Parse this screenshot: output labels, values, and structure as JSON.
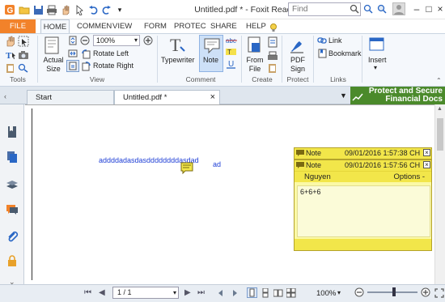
{
  "window": {
    "title": "Untitled.pdf * - Foxit Reader",
    "find_placeholder": "Find"
  },
  "ribbon_tabs": [
    "FILE",
    "HOME",
    "COMMEN",
    "VIEW",
    "FORM",
    "PROTEC",
    "SHARE",
    "HELP"
  ],
  "ribbon": {
    "tools": {
      "label": "Tools"
    },
    "view": {
      "label": "View",
      "actual_size": "Actual\nSize",
      "zoom_value": "100%",
      "rotate_left": "Rotate Left",
      "rotate_right": "Rotate Right"
    },
    "comment": {
      "label": "Comment",
      "typewriter": "Typewriter",
      "note": "Note"
    },
    "create": {
      "label": "Create",
      "from_file": "From\nFile"
    },
    "protect": {
      "label": "Protect",
      "pdf_sign": "PDF\nSign"
    },
    "links": {
      "label": "Links",
      "link": "Link",
      "bookmark": "Bookmark"
    },
    "insert": {
      "label": "Insert"
    }
  },
  "doc_tabs": [
    {
      "label": "Start"
    },
    {
      "label": "Untitled.pdf *"
    }
  ],
  "banner": {
    "line1": "Protect and Secure",
    "line2": "Financial Docs"
  },
  "document": {
    "text1": "addddadasdasddddddddasdad",
    "text2": "ad"
  },
  "notes": [
    {
      "type": "Note",
      "datetime": "09/01/2016 1:57:38 CH"
    },
    {
      "type": "Note",
      "datetime": "09/01/2016 1:57:56 CH",
      "author": "Nguyen",
      "options": "Options -",
      "body": "6+6+6"
    }
  ],
  "status": {
    "page_field": "1 / 1",
    "zoom": "100%"
  },
  "colors": {
    "file_tab": "#f2822a",
    "banner_bg": "#4b8a2b",
    "note_header": "#f2e64a",
    "note_body": "#fbf9a6",
    "doc_text": "#1f3fd6"
  }
}
